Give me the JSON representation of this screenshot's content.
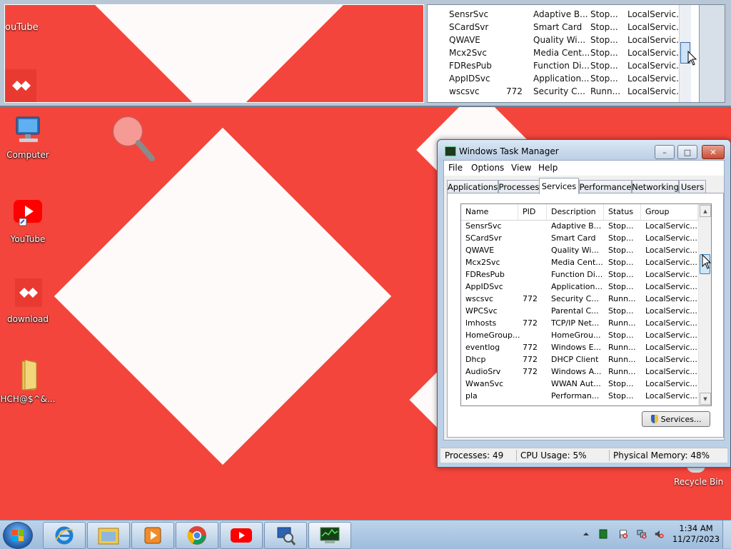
{
  "desktop": {
    "icons": [
      {
        "label": "Computer",
        "icon": "computer-icon"
      },
      {
        "label": "YouTube",
        "icon": "youtube-icon"
      },
      {
        "label": "download",
        "icon": "anydesk-icon"
      },
      {
        "label": "HCH@$^&...",
        "icon": "folder-icon"
      },
      {
        "label": "Recycle Bin",
        "icon": "recycle-bin-icon"
      }
    ],
    "magnifier": "magnifier-lens-icon"
  },
  "zoom_preview": {
    "youtube_label": "ouTube",
    "rows": [
      {
        "name": "SensrSvc",
        "pid": "",
        "description": "Adaptive B...",
        "status": "Stop...",
        "group": "LocalServic..."
      },
      {
        "name": "SCardSvr",
        "pid": "",
        "description": "Smart Card",
        "status": "Stop...",
        "group": "LocalServic..."
      },
      {
        "name": "QWAVE",
        "pid": "",
        "description": "Quality Wi...",
        "status": "Stop...",
        "group": "LocalServic..."
      },
      {
        "name": "Mcx2Svc",
        "pid": "",
        "description": "Media Cent...",
        "status": "Stop...",
        "group": "LocalServic..."
      },
      {
        "name": "FDResPub",
        "pid": "",
        "description": "Function Di...",
        "status": "Stop...",
        "group": "LocalServic..."
      },
      {
        "name": "AppIDSvc",
        "pid": "",
        "description": "Application...",
        "status": "Stop...",
        "group": "LocalServic..."
      },
      {
        "name": "wscsvc",
        "pid": "772",
        "description": "Security C...",
        "status": "Runn...",
        "group": "LocalServic..."
      }
    ]
  },
  "task_manager": {
    "title": "Windows Task Manager",
    "menu": [
      "File",
      "Options",
      "View",
      "Help"
    ],
    "tabs": [
      "Applications",
      "Processes",
      "Services",
      "Performance",
      "Networking",
      "Users"
    ],
    "active_tab": "Services",
    "columns": [
      "Name",
      "PID",
      "Description",
      "Status",
      "Group"
    ],
    "services": [
      {
        "name": "SensrSvc",
        "pid": "",
        "description": "Adaptive B...",
        "status": "Stop...",
        "group": "LocalServic..."
      },
      {
        "name": "SCardSvr",
        "pid": "",
        "description": "Smart Card",
        "status": "Stop...",
        "group": "LocalServic..."
      },
      {
        "name": "QWAVE",
        "pid": "",
        "description": "Quality Wi...",
        "status": "Stop...",
        "group": "LocalServic..."
      },
      {
        "name": "Mcx2Svc",
        "pid": "",
        "description": "Media Cent...",
        "status": "Stop...",
        "group": "LocalServic..."
      },
      {
        "name": "FDResPub",
        "pid": "",
        "description": "Function Di...",
        "status": "Stop...",
        "group": "LocalServic..."
      },
      {
        "name": "AppIDSvc",
        "pid": "",
        "description": "Application...",
        "status": "Stop...",
        "group": "LocalServic..."
      },
      {
        "name": "wscsvc",
        "pid": "772",
        "description": "Security C...",
        "status": "Runn...",
        "group": "LocalServic..."
      },
      {
        "name": "WPCSvc",
        "pid": "",
        "description": "Parental C...",
        "status": "Stop...",
        "group": "LocalServic..."
      },
      {
        "name": "lmhosts",
        "pid": "772",
        "description": "TCP/IP Net...",
        "status": "Runn...",
        "group": "LocalServic..."
      },
      {
        "name": "HomeGroup...",
        "pid": "",
        "description": "HomeGrou...",
        "status": "Stop...",
        "group": "LocalServic..."
      },
      {
        "name": "eventlog",
        "pid": "772",
        "description": "Windows E...",
        "status": "Runn...",
        "group": "LocalServic..."
      },
      {
        "name": "Dhcp",
        "pid": "772",
        "description": "DHCP Client",
        "status": "Runn...",
        "group": "LocalServic..."
      },
      {
        "name": "AudioSrv",
        "pid": "772",
        "description": "Windows A...",
        "status": "Runn...",
        "group": "LocalServic..."
      },
      {
        "name": "WwanSvc",
        "pid": "",
        "description": "WWAN Aut...",
        "status": "Stop...",
        "group": "LocalServic..."
      },
      {
        "name": "pla",
        "pid": "",
        "description": "Performan...",
        "status": "Stop...",
        "group": "LocalServic..."
      }
    ],
    "services_button": "Services...",
    "status": {
      "processes": "Processes: 49",
      "cpu": "CPU Usage: 5%",
      "memory": "Physical Memory: 48%"
    }
  },
  "taskbar": {
    "pinned": [
      "internet-explorer-icon",
      "file-explorer-icon",
      "media-player-icon",
      "chrome-icon",
      "youtube-icon",
      "magnifier-app-icon",
      "task-manager-icon"
    ],
    "clock_time": "1:34 AM",
    "clock_date": "11/27/2023",
    "tray": [
      "show-hidden-icons-chevron",
      "tray-app-icon",
      "action-center-flag-icon",
      "network-icon",
      "volume-muted-icon"
    ]
  },
  "colors": {
    "wallpaper_red": "#f4453c",
    "wallpaper_white": "#fffafa",
    "selection_blue": "#3b6aa3"
  }
}
